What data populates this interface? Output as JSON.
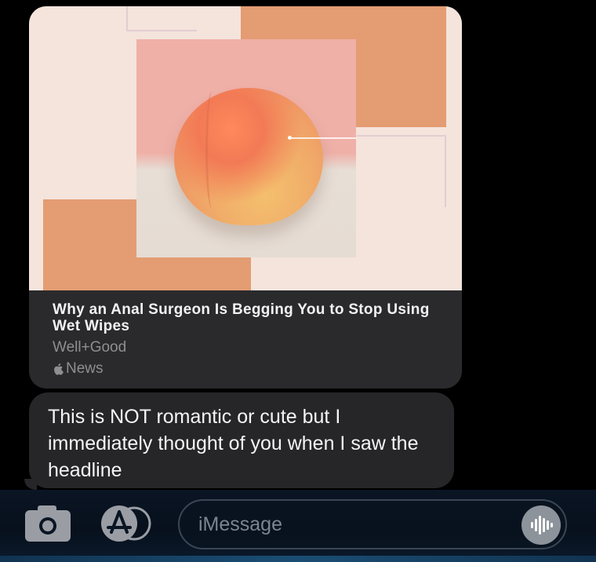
{
  "link_preview": {
    "title": "Why an Anal Surgeon Is Begging You to Stop Using Wet Wipes",
    "source": "Well+Good",
    "app_name": "News",
    "app_icon": "apple-icon",
    "image_description_icon": "peach-image"
  },
  "message": {
    "text": "This is NOT romantic or cute but I immediately thought of you when I saw the headline"
  },
  "input_bar": {
    "placeholder": "iMessage",
    "camera_icon": "camera-icon",
    "apps_icon": "app-store-icon",
    "audio_icon": "audio-waveform-icon"
  },
  "colors": {
    "background": "#000000",
    "bubble": "#262628",
    "card_footer": "#2a2a2c",
    "accent_orange": "#e49c72",
    "placeholder_text": "#7b8592"
  }
}
